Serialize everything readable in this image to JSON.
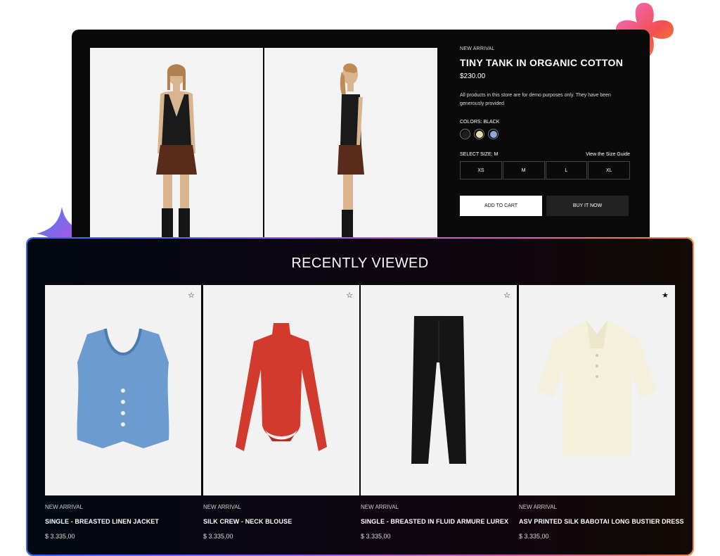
{
  "product": {
    "tag": "NEW ARRIVAL",
    "title": "TINY TANK IN ORGANIC COTTON",
    "price": "$230.00",
    "note": "All products in this store are for demo purposes only. They have been generously provided",
    "colors_label": "COLORS: BLACK",
    "colors": [
      "#1f1f1f",
      "#e6dcaa",
      "#8ea8dc"
    ],
    "size_label": "SELECT SIZE: M",
    "size_guide": "View the Size Guide",
    "sizes": [
      "XS",
      "M",
      "L",
      "XL"
    ],
    "add_to_cart": "ADD TO CART",
    "buy_now": "BUY IT NOW"
  },
  "recently_viewed": {
    "title": "RECENTLY VIEWED",
    "items": [
      {
        "tag": "NEW ARRIVAL",
        "name": "SINGLE - BREASTED LINEN JACKET",
        "price": "$ 3.335,00",
        "star": "☆"
      },
      {
        "tag": "NEW ARRIVAL",
        "name": "SILK CREW - NECK BLOUSE",
        "price": "$ 3.335,00",
        "star": "☆"
      },
      {
        "tag": "NEW ARRIVAL",
        "name": "SINGLE - BREASTED IN FLUID ARMURE LUREX",
        "price": "$ 3.335,00",
        "star": "☆"
      },
      {
        "tag": "NEW ARRIVAL",
        "name": "ASV PRINTED SILK BABOTAI LONG BUSTIER DRESS",
        "price": "$ 3.335,00",
        "star": "★"
      }
    ]
  },
  "accent_colors": {
    "gradient": [
      "#2b6ff0",
      "#9b5cf6",
      "#e85bb5",
      "#f58a3a"
    ]
  }
}
